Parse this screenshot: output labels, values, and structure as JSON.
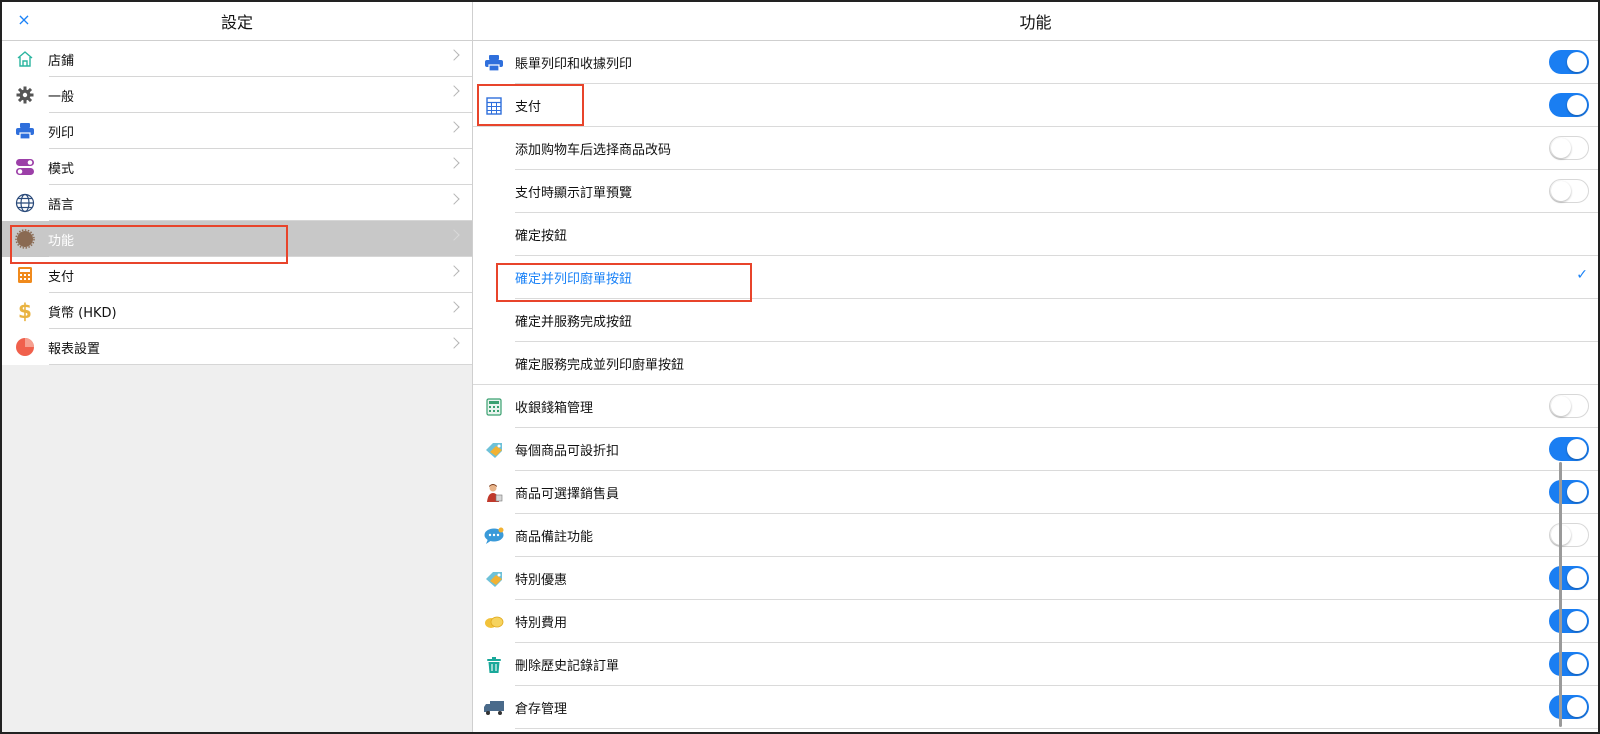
{
  "left": {
    "title": "設定",
    "close_icon": "×",
    "items": [
      {
        "label": "店鋪",
        "icon": "home-icon"
      },
      {
        "label": "一般",
        "icon": "gear-icon"
      },
      {
        "label": "列印",
        "icon": "printer-icon"
      },
      {
        "label": "模式",
        "icon": "toggles-icon"
      },
      {
        "label": "語言",
        "icon": "globe-icon"
      },
      {
        "label": "功能",
        "icon": "function-icon",
        "selected": true
      },
      {
        "label": "支付",
        "icon": "calculator-icon"
      },
      {
        "label": "貨幣 (HKD)",
        "icon": "dollar-icon"
      },
      {
        "label": "報表設置",
        "icon": "pie-chart-icon"
      }
    ]
  },
  "right": {
    "title": "功能",
    "rows": [
      {
        "label": "賬單列印和收據列印",
        "icon": "printer-icon",
        "toggle": "on"
      },
      {
        "label": "支付",
        "icon": "calculator-icon",
        "toggle": "on",
        "full": true
      },
      {
        "label": "添加购物车后选择商品改码",
        "toggle": "off"
      },
      {
        "label": "支付時顯示訂單預覽",
        "toggle": "off"
      },
      {
        "label": "確定按鈕"
      },
      {
        "label": "確定并列印廚單按鈕",
        "checked": true
      },
      {
        "label": "確定并服務完成按鈕"
      },
      {
        "label": "確定服務完成並列印廚單按鈕",
        "full": true
      },
      {
        "label": "收銀錢箱管理",
        "icon": "cash-drawer-icon",
        "toggle": "off"
      },
      {
        "label": "每個商品可設折扣",
        "icon": "discount-tag-icon",
        "toggle": "on"
      },
      {
        "label": "商品可選擇銷售員",
        "icon": "salesperson-icon",
        "toggle": "on"
      },
      {
        "label": "商品備註功能",
        "icon": "note-bubble-icon",
        "toggle": "off"
      },
      {
        "label": "特別優惠",
        "icon": "offer-tag-icon",
        "toggle": "on"
      },
      {
        "label": "特別費用",
        "icon": "coins-icon",
        "toggle": "on"
      },
      {
        "label": "刪除歷史記錄訂單",
        "icon": "trash-icon",
        "toggle": "on"
      },
      {
        "label": "倉存管理",
        "icon": "truck-icon",
        "toggle": "on"
      }
    ],
    "check_mark": "✓"
  },
  "colors": {
    "accent": "#1a7ef2",
    "highlight": "#e8442b"
  }
}
